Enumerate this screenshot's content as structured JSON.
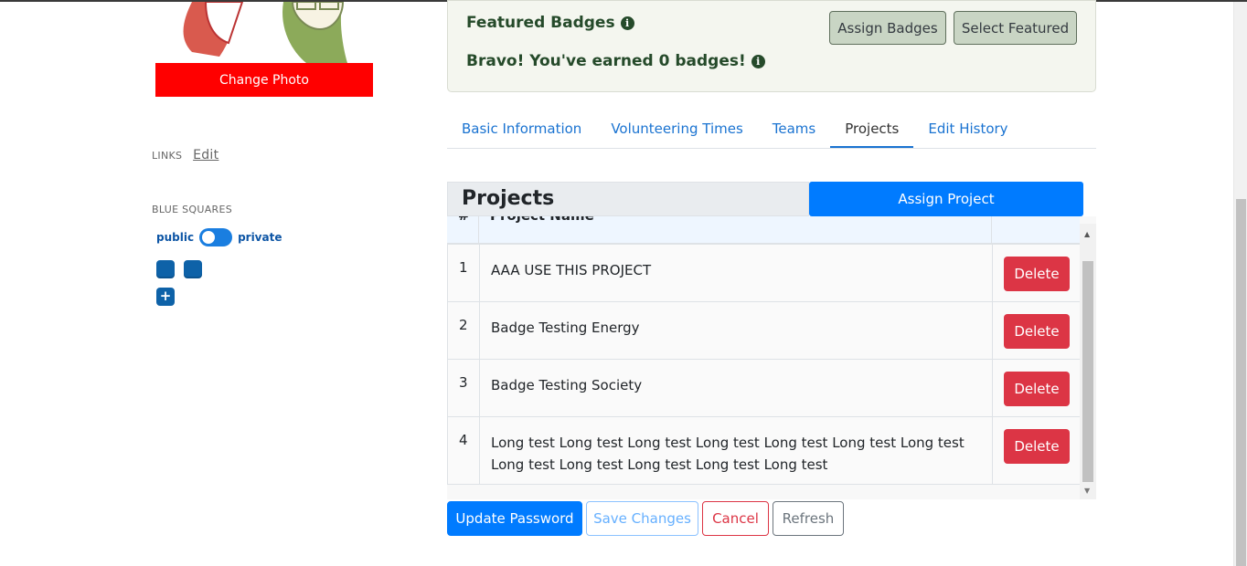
{
  "profile": {
    "change_photo_label": "Change Photo",
    "links_label": "LINKS",
    "links_edit_label": "Edit",
    "blue_squares_label": "BLUE SQUARES",
    "toggle_left_label": "public",
    "toggle_right_label": "private",
    "add_square_label": "+"
  },
  "badges": {
    "title": "Featured Badges",
    "subtitle": "Bravo! You've earned 0 badges!",
    "assign_label": "Assign Badges",
    "select_label": "Select Featured"
  },
  "tabs": [
    {
      "label": "Basic Information"
    },
    {
      "label": "Volunteering Times"
    },
    {
      "label": "Teams"
    },
    {
      "label": "Projects"
    },
    {
      "label": "Edit History"
    }
  ],
  "projects": {
    "title": "Projects",
    "assign_label": "Assign Project",
    "columns": [
      "#",
      "Project Name"
    ],
    "delete_label": "Delete",
    "rows": [
      {
        "num": "1",
        "name": "AAA USE THIS PROJECT"
      },
      {
        "num": "2",
        "name": "Badge Testing Energy"
      },
      {
        "num": "3",
        "name": "Badge Testing Society"
      },
      {
        "num": "4",
        "name": "Long test Long test Long test Long test Long test Long test Long test Long test Long test Long test Long test Long test"
      }
    ]
  },
  "actions": {
    "update_password": "Update Password",
    "save_changes": "Save Changes",
    "cancel": "Cancel",
    "refresh": "Refresh"
  },
  "colors": {
    "primary": "#007bff",
    "danger": "#dc3545",
    "change_photo_bg": "#ff0000",
    "blue_square": "#0e62a8"
  }
}
